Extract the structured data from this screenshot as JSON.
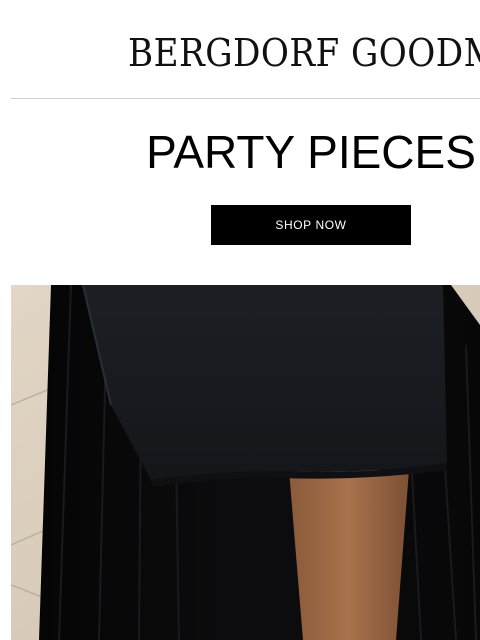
{
  "header": {
    "logo_text": "BERGDORF GOODMAN"
  },
  "promo": {
    "headline": "PARTY PIECES",
    "cta_label": "SHOP NOW"
  },
  "colors": {
    "background": "#ffffff",
    "text": "#000000",
    "cta_background": "#000000",
    "cta_text": "#ffffff",
    "divider": "#cfcfcf"
  }
}
